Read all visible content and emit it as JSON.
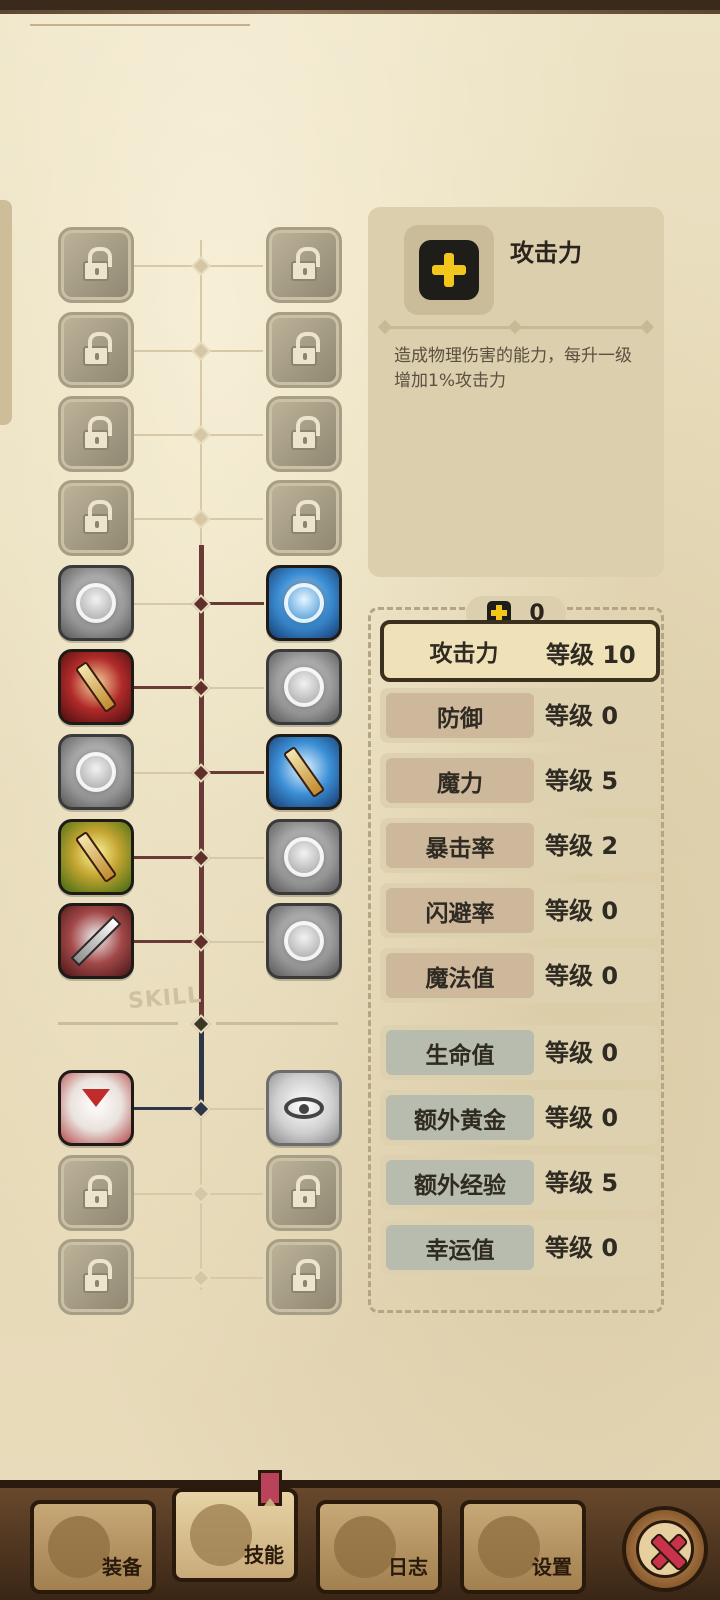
{
  "info": {
    "title": "攻击力",
    "description": "造成物理伤害的能力，每升一级增加1%攻击力",
    "icon": "plus-icon"
  },
  "skill_points": {
    "icon": "plus-icon",
    "value": "0"
  },
  "tree": {
    "divider_label": "SKILL"
  },
  "stats": [
    {
      "name": "攻击力",
      "level": "等级 10",
      "selected": true,
      "group": "warm"
    },
    {
      "name": "防御",
      "level": "等级 0",
      "group": "warm"
    },
    {
      "name": "魔力",
      "level": "等级 5",
      "group": "warm"
    },
    {
      "name": "暴击率",
      "level": "等级 2",
      "group": "warm"
    },
    {
      "name": "闪避率",
      "level": "等级 0",
      "group": "warm"
    },
    {
      "name": "魔法值",
      "level": "等级 0",
      "group": "warm"
    },
    {
      "name": "生命值",
      "level": "等级 0",
      "group": "cool"
    },
    {
      "name": "额外黄金",
      "level": "等级 0",
      "group": "cool"
    },
    {
      "name": "额外经验",
      "level": "等级 5",
      "group": "cool"
    },
    {
      "name": "幸运值",
      "level": "等级 0",
      "group": "cool"
    }
  ],
  "nav": {
    "equipment": "装备",
    "skills": "技能",
    "log": "日志",
    "settings": "设置"
  },
  "colors": {
    "accent_yellow": "#f3c61c",
    "tree_red": "#6a3b36",
    "tree_blue": "#2d3748",
    "close_red": "#c8324a"
  }
}
